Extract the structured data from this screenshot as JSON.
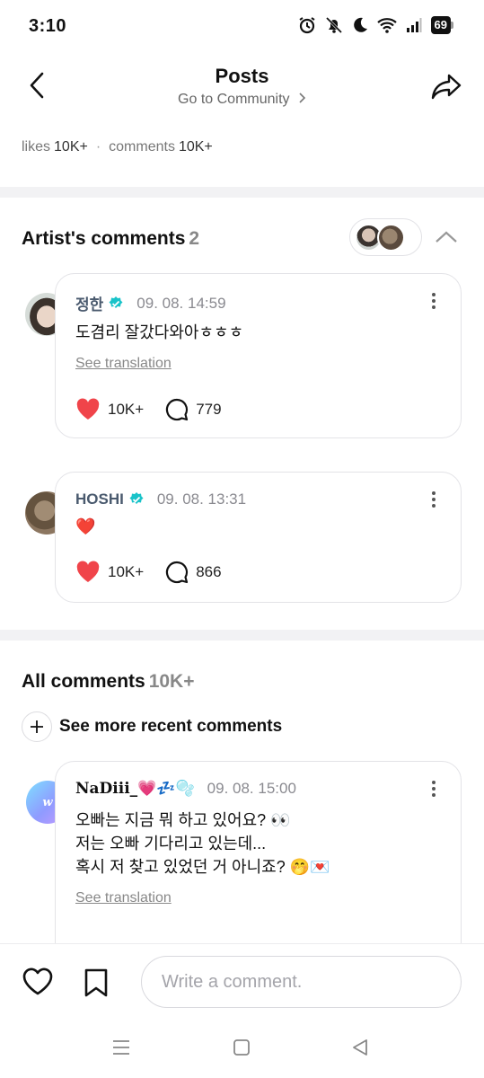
{
  "status_bar": {
    "time": "3:10",
    "battery": "69"
  },
  "header": {
    "title": "Posts",
    "subtitle": "Go to Community"
  },
  "stats": {
    "likes_label": "likes",
    "likes_value": "10K+",
    "separator": "·",
    "comments_label": "comments",
    "comments_value": "10K+"
  },
  "artist_comments": {
    "title": "Artist's comments",
    "count": "2",
    "items": [
      {
        "author": "정한",
        "time": "09. 08. 14:59",
        "text": "도겸리 잘갔다와아ㅎㅎㅎ",
        "see_translation": "See translation",
        "likes": "10K+",
        "replies": "779"
      },
      {
        "author": "HOSHI",
        "time": "09. 08. 13:31",
        "text": "❤️",
        "likes": "10K+",
        "replies": "866"
      }
    ]
  },
  "all_comments": {
    "title": "All comments",
    "count": "10K+",
    "see_more": "See more recent comments",
    "items": [
      {
        "avatar_letter": "w",
        "author": "NaDiii_💗💤🫧",
        "time": "09. 08. 15:00",
        "lines": [
          "오빠는 지금 뭐 하고 있어요? 👀",
          "저는 오빠 기다리고 있는데...",
          "혹시 저 찾고 있었던 거 아니죠? 🤭💌"
        ],
        "see_translation": "See translation"
      }
    ]
  },
  "composer": {
    "placeholder": "Write a comment."
  },
  "colors": {
    "heart": "#f0444a",
    "verified": "#19c3c9",
    "divider": "#f2f2f4"
  },
  "icons": [
    "back-icon",
    "share-icon",
    "verified-icon",
    "heart-icon",
    "comment-bubble-icon",
    "plus-icon",
    "bookmark-icon"
  ]
}
